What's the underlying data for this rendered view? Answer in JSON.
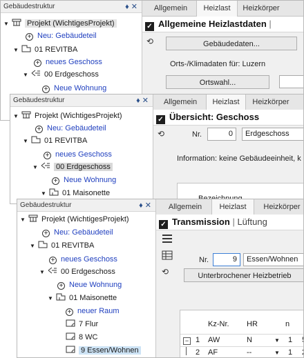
{
  "window1": {
    "tree": {
      "header": "Gebäudestruktur",
      "items": [
        {
          "label": "Projekt (WichtigesProjekt)",
          "icon": "project-icon",
          "toggle": "▼"
        },
        {
          "label": "Neu: Gebäudeteil",
          "icon": "add-circle-icon",
          "toggle": ""
        },
        {
          "label": "01 REVITBA",
          "icon": "building-icon",
          "toggle": "▼"
        },
        {
          "label": "neues Geschoss",
          "icon": "add-circle-icon",
          "toggle": ""
        },
        {
          "label": "00 Erdgeschoss",
          "icon": "floor-icon",
          "toggle": "▼"
        },
        {
          "label": "Neue Wohnung",
          "icon": "add-circle-icon",
          "toggle": ""
        }
      ]
    },
    "tabs": [
      "Allgemein",
      "Heizlast",
      "Heizkörper"
    ],
    "active_tab": 1,
    "title": "Allgemeine Heizlastdaten",
    "building_data_button": "Gebäudedaten...",
    "climate_label": "Orts-/Klimadaten für: Luzern",
    "location_button": "Ortswahl..."
  },
  "window2": {
    "tree": {
      "header": "Gebäudestruktur",
      "items": [
        {
          "label": "Projekt (WichtigesProjekt)",
          "toggle": "▼"
        },
        {
          "label": "Neu: Gebäudeteil",
          "toggle": ""
        },
        {
          "label": "01 REVITBA",
          "toggle": "▼"
        },
        {
          "label": "neues Geschoss",
          "toggle": ""
        },
        {
          "label": "00 Erdgeschoss",
          "toggle": "▼"
        },
        {
          "label": "Neue Wohnung",
          "toggle": ""
        },
        {
          "label": "01 Maisonette",
          "toggle": "▼"
        }
      ]
    },
    "tabs": [
      "Allgemein",
      "Heizlast",
      "Heizkörper"
    ],
    "active_tab": 1,
    "title": "Übersicht: Geschoss",
    "nr_label": "Nr.",
    "nr_value": "0",
    "name_value": "Erdgeschoss",
    "info_text": "Information: keine Gebäudeeinheit, k",
    "grid_header": "Bezeichnung"
  },
  "window3": {
    "tree": {
      "header": "Gebäudestruktur",
      "items": [
        {
          "label": "Projekt (WichtigesProjekt)",
          "toggle": "▼"
        },
        {
          "label": "Neu: Gebäudeteil",
          "toggle": ""
        },
        {
          "label": "01 REVITBA",
          "toggle": "▼"
        },
        {
          "label": "neues Geschoss",
          "toggle": ""
        },
        {
          "label": "00 Erdgeschoss",
          "toggle": "▼"
        },
        {
          "label": "Neue Wohnung",
          "toggle": ""
        },
        {
          "label": "01 Maisonette",
          "toggle": "▼"
        },
        {
          "label": "neuer Raum",
          "toggle": ""
        },
        {
          "label": "7 Flur",
          "toggle": ""
        },
        {
          "label": "8 WC",
          "toggle": ""
        },
        {
          "label": "9 Essen/Wohnen",
          "toggle": ""
        }
      ]
    },
    "tabs": [
      "Allgemein",
      "Heizlast",
      "Heizkörper"
    ],
    "active_tab": 1,
    "title": "Transmission",
    "title_secondary": "Lüftung",
    "nr_label": "Nr.",
    "nr_value": "9",
    "name_value": "Essen/Wohnen",
    "interrupted_button": "Unterbrochener Heizbetrieb",
    "table": {
      "headers": [
        "Kz-Nr.",
        "HR",
        "n"
      ],
      "rows": [
        {
          "index": "1",
          "kz": "AW",
          "hr": "N",
          "n": "1",
          "extra": "5"
        },
        {
          "index": "2",
          "kz": "AF",
          "hr": "--",
          "n": "1",
          "extra": "2"
        }
      ]
    }
  },
  "colors": {
    "link_blue": "#1f3fbf",
    "selection": "#cde3f5",
    "panel_bg": "#f0f0f0"
  }
}
